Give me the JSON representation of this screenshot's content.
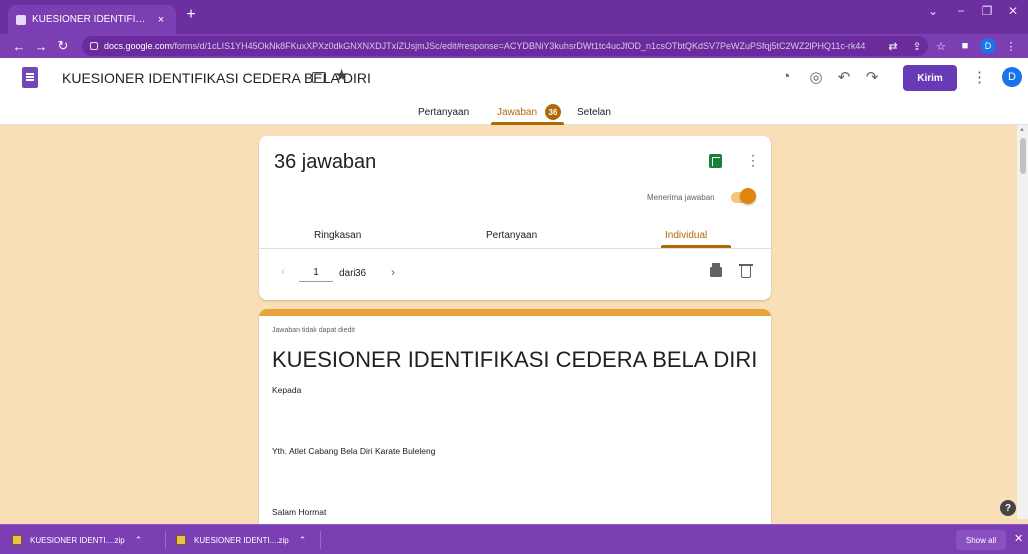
{
  "browser": {
    "tab_title": "KUESIONER IDENTIFIKASI CEDER",
    "tab_close": "×",
    "new_tab": "+",
    "url_host": "docs.google.com",
    "url_path": "/forms/d/1cLIS1YH45OkNk8FKuxXPXz0dkGNXNXDJTxIZUsjmJSc/edit#response=ACYDBNiY3kuhsrDWt1tc4ucJfOD_n1csOTbtQKdSV7PeWZuPSfqj5tC2WZ2lPHQ11c-rk44",
    "profile_initial": "D",
    "window_minimize": "−",
    "window_restore": "❐",
    "window_close": "✕"
  },
  "header": {
    "title": "KUESIONER IDENTIFIKASI CEDERA BELA DIRI",
    "send_label": "Kirim",
    "user_initial": "D"
  },
  "tabs": {
    "questions": "Pertanyaan",
    "responses": "Jawaban",
    "responses_count": "36",
    "settings": "Setelan"
  },
  "summary_card": {
    "count_title": "36 jawaban",
    "accepting_label": "Menerima jawaban",
    "accepting": true,
    "subtabs": [
      "Ringkasan",
      "Pertanyaan",
      "Individual"
    ],
    "page_current": "1",
    "page_of": "dari",
    "page_total": "36"
  },
  "form_card": {
    "note": "Jawaban tidak dapat diedit",
    "heading": "KUESIONER IDENTIFIKASI CEDERA BELA DIRI",
    "line1": "Kepada",
    "line2": "Yth. Atlet Cabang Bela Diri Karate Buleleng",
    "line3": "Salam Hormat"
  },
  "downloads": {
    "items": [
      "KUESIONER IDENTI....zip",
      "KUESIONER IDENTI....zip"
    ],
    "show_all": "Show all",
    "close": "✕"
  },
  "colors": {
    "browser": "#7c3fb3",
    "accent": "#b06a05",
    "background": "#f9dfb8",
    "send_button": "#673ab7"
  }
}
